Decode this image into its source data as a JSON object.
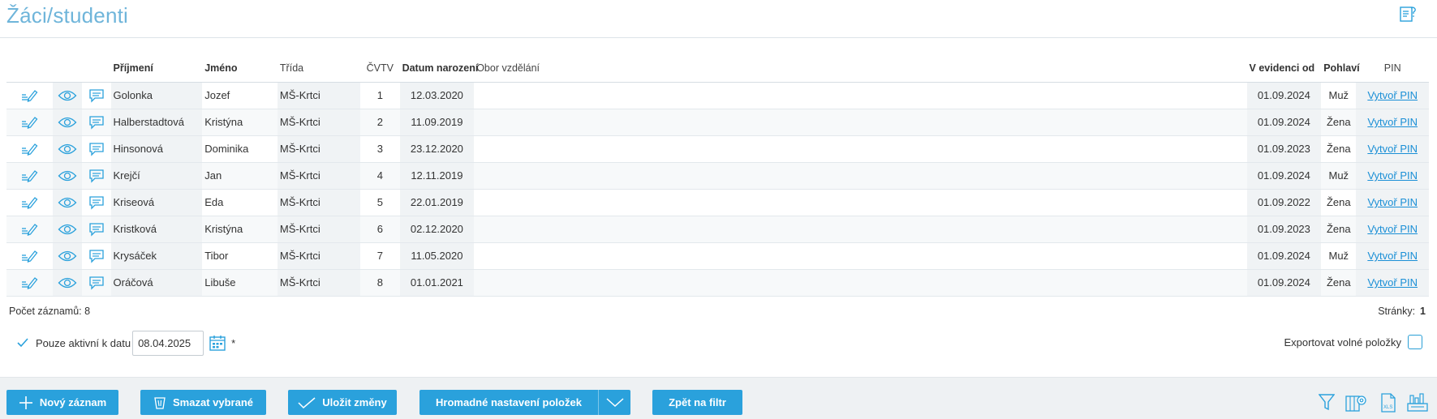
{
  "page": {
    "title": "Žáci/studenti"
  },
  "table": {
    "columns": {
      "surname": "Příjmení",
      "name": "Jméno",
      "class": "Třída",
      "cvtv": "ČVTV",
      "birth": "Datum narození",
      "field": "Obor vzdělání",
      "since": "V evidenci od",
      "gender": "Pohlaví",
      "pin": "PIN"
    },
    "rows": [
      {
        "surname": "Golonka",
        "name": "Jozef",
        "class": "MŠ-Krtci",
        "cvtv": "1",
        "birth": "12.03.2020",
        "field": "",
        "since": "01.09.2024",
        "gender": "Muž",
        "pin": "Vytvoř PIN"
      },
      {
        "surname": "Halberstadtová",
        "name": "Kristýna",
        "class": "MŠ-Krtci",
        "cvtv": "2",
        "birth": "11.09.2019",
        "field": "",
        "since": "01.09.2024",
        "gender": "Žena",
        "pin": "Vytvoř PIN"
      },
      {
        "surname": "Hinsonová",
        "name": "Dominika",
        "class": "MŠ-Krtci",
        "cvtv": "3",
        "birth": "23.12.2020",
        "field": "",
        "since": "01.09.2023",
        "gender": "Žena",
        "pin": "Vytvoř PIN"
      },
      {
        "surname": "Krejčí",
        "name": "Jan",
        "class": "MŠ-Krtci",
        "cvtv": "4",
        "birth": "12.11.2019",
        "field": "",
        "since": "01.09.2024",
        "gender": "Muž",
        "pin": "Vytvoř PIN"
      },
      {
        "surname": "Kriseová",
        "name": "Eda",
        "class": "MŠ-Krtci",
        "cvtv": "5",
        "birth": "22.01.2019",
        "field": "",
        "since": "01.09.2022",
        "gender": "Žena",
        "pin": "Vytvoř PIN"
      },
      {
        "surname": "Kristková",
        "name": "Kristýna",
        "class": "MŠ-Krtci",
        "cvtv": "6",
        "birth": "02.12.2020",
        "field": "",
        "since": "01.09.2023",
        "gender": "Žena",
        "pin": "Vytvoř PIN"
      },
      {
        "surname": "Krysáček",
        "name": "Tibor",
        "class": "MŠ-Krtci",
        "cvtv": "7",
        "birth": "11.05.2020",
        "field": "",
        "since": "01.09.2024",
        "gender": "Muž",
        "pin": "Vytvoř PIN"
      },
      {
        "surname": "Oráčová",
        "name": "Libuše",
        "class": "MŠ-Krtci",
        "cvtv": "8",
        "birth": "01.01.2021",
        "field": "",
        "since": "01.09.2024",
        "gender": "Žena",
        "pin": "Vytvoř PIN"
      }
    ]
  },
  "footer": {
    "record_count": "Počet záznamů: 8",
    "pages_label": "Stránky:",
    "pages_value": "1"
  },
  "filter": {
    "active_label": "Pouze aktivní k datu",
    "date_value": "08.04.2025",
    "required_mark": "*",
    "export_label": "Exportovat volné položky"
  },
  "toolbar": {
    "new_record": "Nový záznam",
    "delete_selected": "Smazat vybrané",
    "save_changes": "Uložit změny",
    "bulk_settings": "Hromadné nastavení položek",
    "back_to_filter": "Zpět na filtr"
  },
  "icons": {
    "accent": "#2aa1dc",
    "row_actions": [
      "edit-icon",
      "view-icon",
      "comment-icon"
    ],
    "toolbar_right": [
      "filter-icon",
      "column-settings-icon",
      "export-xls-icon",
      "print-report-icon"
    ]
  }
}
